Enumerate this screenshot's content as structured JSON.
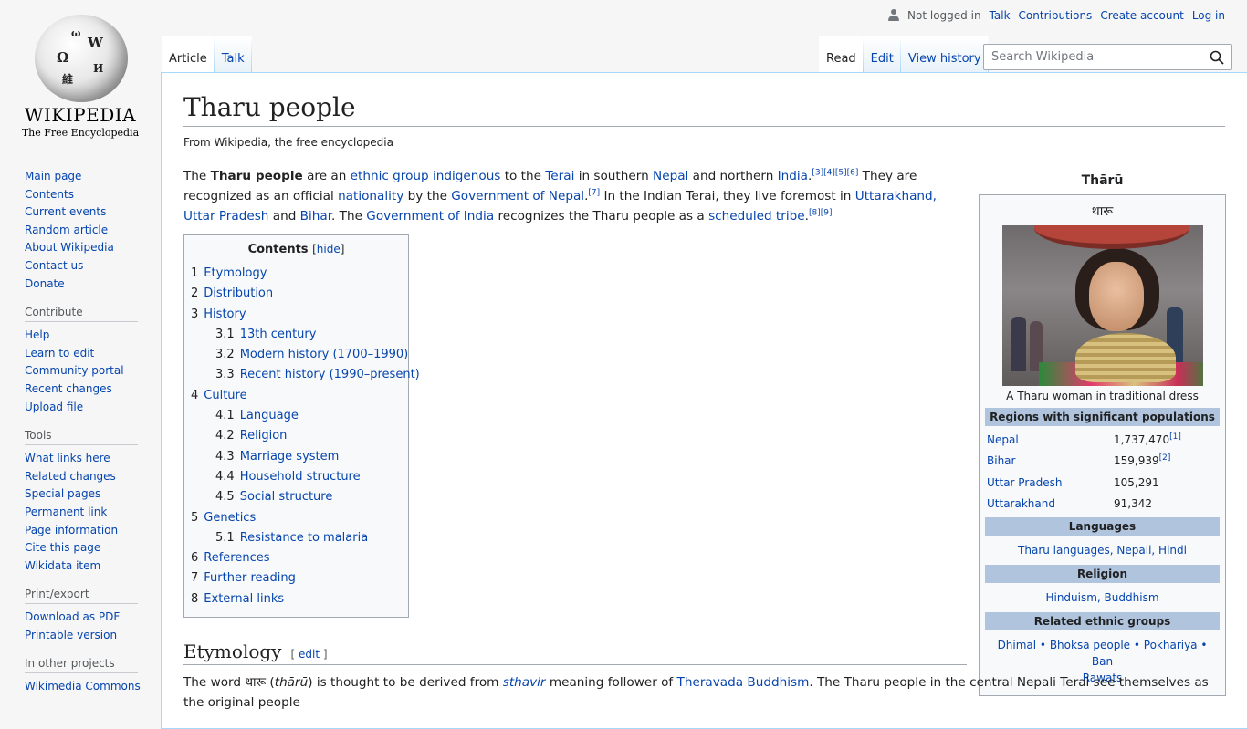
{
  "personal": {
    "status": "Not logged in",
    "talk": "Talk",
    "contributions": "Contributions",
    "create_account": "Create account",
    "login": "Log in"
  },
  "logo": {
    "wordmark": "WIKIPEDIA",
    "tagline": "The Free Encyclopedia"
  },
  "sidebar": {
    "navigation": [
      "Main page",
      "Contents",
      "Current events",
      "Random article",
      "About Wikipedia",
      "Contact us",
      "Donate"
    ],
    "contribute_heading": "Contribute",
    "contribute": [
      "Help",
      "Learn to edit",
      "Community portal",
      "Recent changes",
      "Upload file"
    ],
    "tools_heading": "Tools",
    "tools": [
      "What links here",
      "Related changes",
      "Special pages",
      "Permanent link",
      "Page information",
      "Cite this page",
      "Wikidata item"
    ],
    "print_heading": "Print/export",
    "print": [
      "Download as PDF",
      "Printable version"
    ],
    "other_heading": "In other projects",
    "other": [
      "Wikimedia Commons"
    ]
  },
  "tabs": {
    "article": "Article",
    "talk": "Talk",
    "read": "Read",
    "edit": "Edit",
    "history": "View history"
  },
  "search": {
    "placeholder": "Search Wikipedia"
  },
  "page": {
    "title": "Tharu people",
    "site_sub": "From Wikipedia, the free encyclopedia"
  },
  "lead": {
    "t1": "The ",
    "bold": "Tharu people",
    "t2": " are an ",
    "l_ethnic": "ethnic group",
    "t3": " ",
    "l_indigenous": "indigenous",
    "t4": " to the ",
    "l_terai": "Terai",
    "t5": " in southern ",
    "l_nepal": "Nepal",
    "t6": " and northern ",
    "l_india": "India",
    "refs1": "[3][4][5][6]",
    "t7": " They are recognized as an official ",
    "l_nationality": "nationality",
    "t8": " by the ",
    "l_gov_nepal": "Government of Nepal",
    "refs2": "[7]",
    "t9": " In the Indian Terai, they live foremost in ",
    "l_uttarakhand": "Uttarakhand",
    "t10": ", ",
    "l_up": "Uttar Pradesh",
    "t11": " and ",
    "l_bihar": "Bihar",
    "t12": ". The ",
    "l_gov_india": "Government of India",
    "t13": " recognizes the Tharu people as a ",
    "l_st": "scheduled tribe",
    "refs3": "[8][9]"
  },
  "toc": {
    "title": "Contents",
    "toggle": "hide",
    "items": [
      {
        "num": "1",
        "text": "Etymology",
        "level": 1
      },
      {
        "num": "2",
        "text": "Distribution",
        "level": 1
      },
      {
        "num": "3",
        "text": "History",
        "level": 1
      },
      {
        "num": "3.1",
        "text": "13th century",
        "level": 2
      },
      {
        "num": "3.2",
        "text": "Modern history (1700–1990)",
        "level": 2
      },
      {
        "num": "3.3",
        "text": "Recent history (1990–present)",
        "level": 2
      },
      {
        "num": "4",
        "text": "Culture",
        "level": 1
      },
      {
        "num": "4.1",
        "text": "Language",
        "level": 2
      },
      {
        "num": "4.2",
        "text": "Religion",
        "level": 2
      },
      {
        "num": "4.3",
        "text": "Marriage system",
        "level": 2
      },
      {
        "num": "4.4",
        "text": "Household structure",
        "level": 2
      },
      {
        "num": "4.5",
        "text": "Social structure",
        "level": 2
      },
      {
        "num": "5",
        "text": "Genetics",
        "level": 1
      },
      {
        "num": "5.1",
        "text": "Resistance to malaria",
        "level": 2
      },
      {
        "num": "6",
        "text": "References",
        "level": 1
      },
      {
        "num": "7",
        "text": "Further reading",
        "level": 1
      },
      {
        "num": "8",
        "text": "External links",
        "level": 1
      }
    ]
  },
  "infobox": {
    "title": "Thārū",
    "native": "थारू",
    "caption": "A Tharu woman in traditional dress",
    "regions_heading": "Regions with significant populations",
    "regions": [
      {
        "name": "Nepal",
        "value": "1,737,470",
        "ref": "[1]"
      },
      {
        "name": "Bihar",
        "value": "159,939",
        "ref": "[2]"
      },
      {
        "name": "Uttar Pradesh",
        "value": "105,291",
        "ref": ""
      },
      {
        "name": "Uttarakhand",
        "value": "91,342",
        "ref": ""
      }
    ],
    "languages_heading": "Languages",
    "languages": "Tharu languages, Nepali, Hindi",
    "religion_heading": "Religion",
    "religion": "Hinduism, Buddhism",
    "related_heading": "Related ethnic groups",
    "related_1": "Dhimal • Bhoksa people • Pokhariya • Ban",
    "related_2": "Rawats"
  },
  "etymology": {
    "heading": "Etymology",
    "edit_open": "[ ",
    "edit": "edit",
    "edit_close": " ]",
    "t1": "The word थारू (",
    "tharu_italic": "thārū",
    "t2": ") is thought to be derived from ",
    "l_sthavir": "sthavir",
    "t3": " meaning follower of ",
    "l_theravada": "Theravada Buddhism",
    "t4": ". The Tharu people in the central Nepali Terai see themselves as the original people"
  },
  "colors": {
    "link": "#0645ad",
    "infobox_header": "#b0c4de",
    "border": "#a2a9b1",
    "tab_border": "#a7d7f9"
  }
}
